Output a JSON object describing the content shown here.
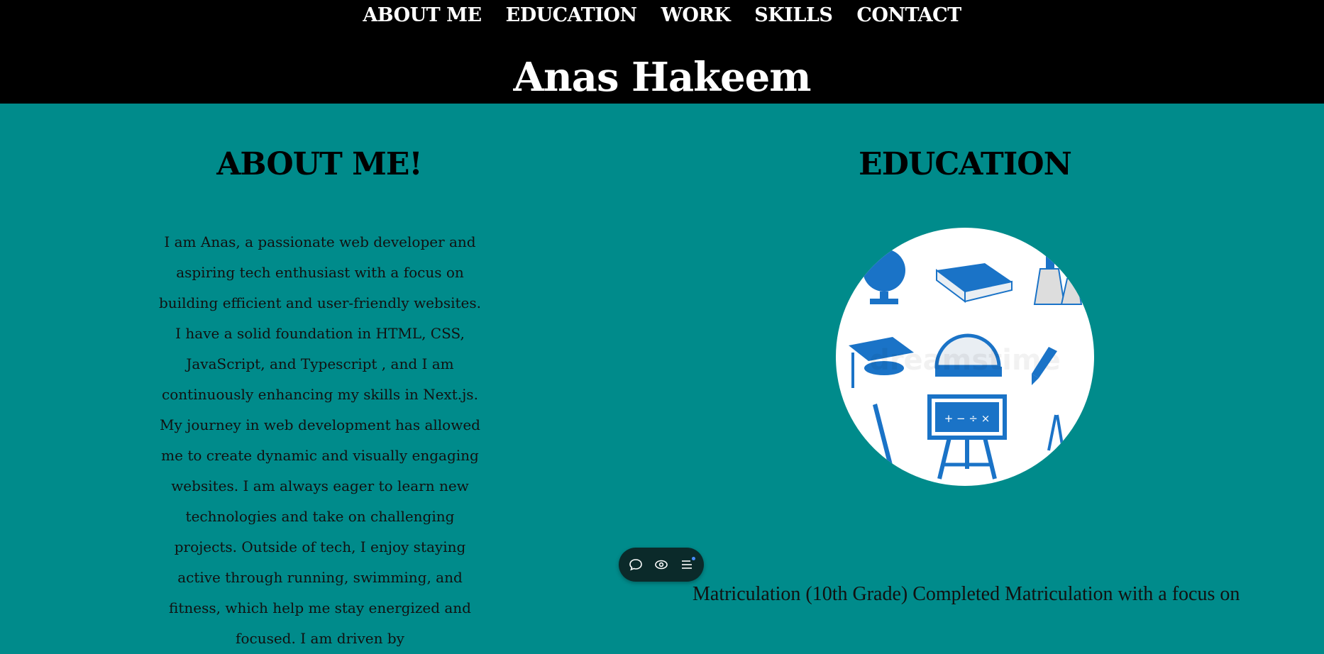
{
  "nav": {
    "items": [
      {
        "label": "ABOUT ME"
      },
      {
        "label": "EDUCATION"
      },
      {
        "label": "WORK"
      },
      {
        "label": "SKILLS"
      },
      {
        "label": "CONTACT"
      }
    ]
  },
  "header": {
    "title": "Anas Hakeem"
  },
  "about": {
    "heading": "ABOUT ME!",
    "text": "I am Anas, a passionate web developer and aspiring tech enthusiast with a focus on building efficient and user-friendly websites. I have a solid foundation in HTML, CSS, JavaScript, and Typescript , and I am continuously enhancing my skills in Next.js. My journey in web development has allowed me to create dynamic and visually engaging websites. I am always eager to learn new technologies and take on challenging projects. Outside of tech, I enjoy staying active through running, swimming, and fitness, which help me stay energized and focused. I am driven by"
  },
  "education": {
    "heading": "EDUCATION",
    "image_icon": "education-illustration",
    "board_symbols": "+ − ÷ ×",
    "caption": "Matriculation (10th Grade) Completed Matriculation with a focus on"
  },
  "toolbar": {
    "icons": [
      "chat-icon",
      "eye-icon",
      "menu-icon"
    ]
  },
  "colors": {
    "background": "#008b8b",
    "header": "#000000",
    "accent": "#1a73c7"
  }
}
